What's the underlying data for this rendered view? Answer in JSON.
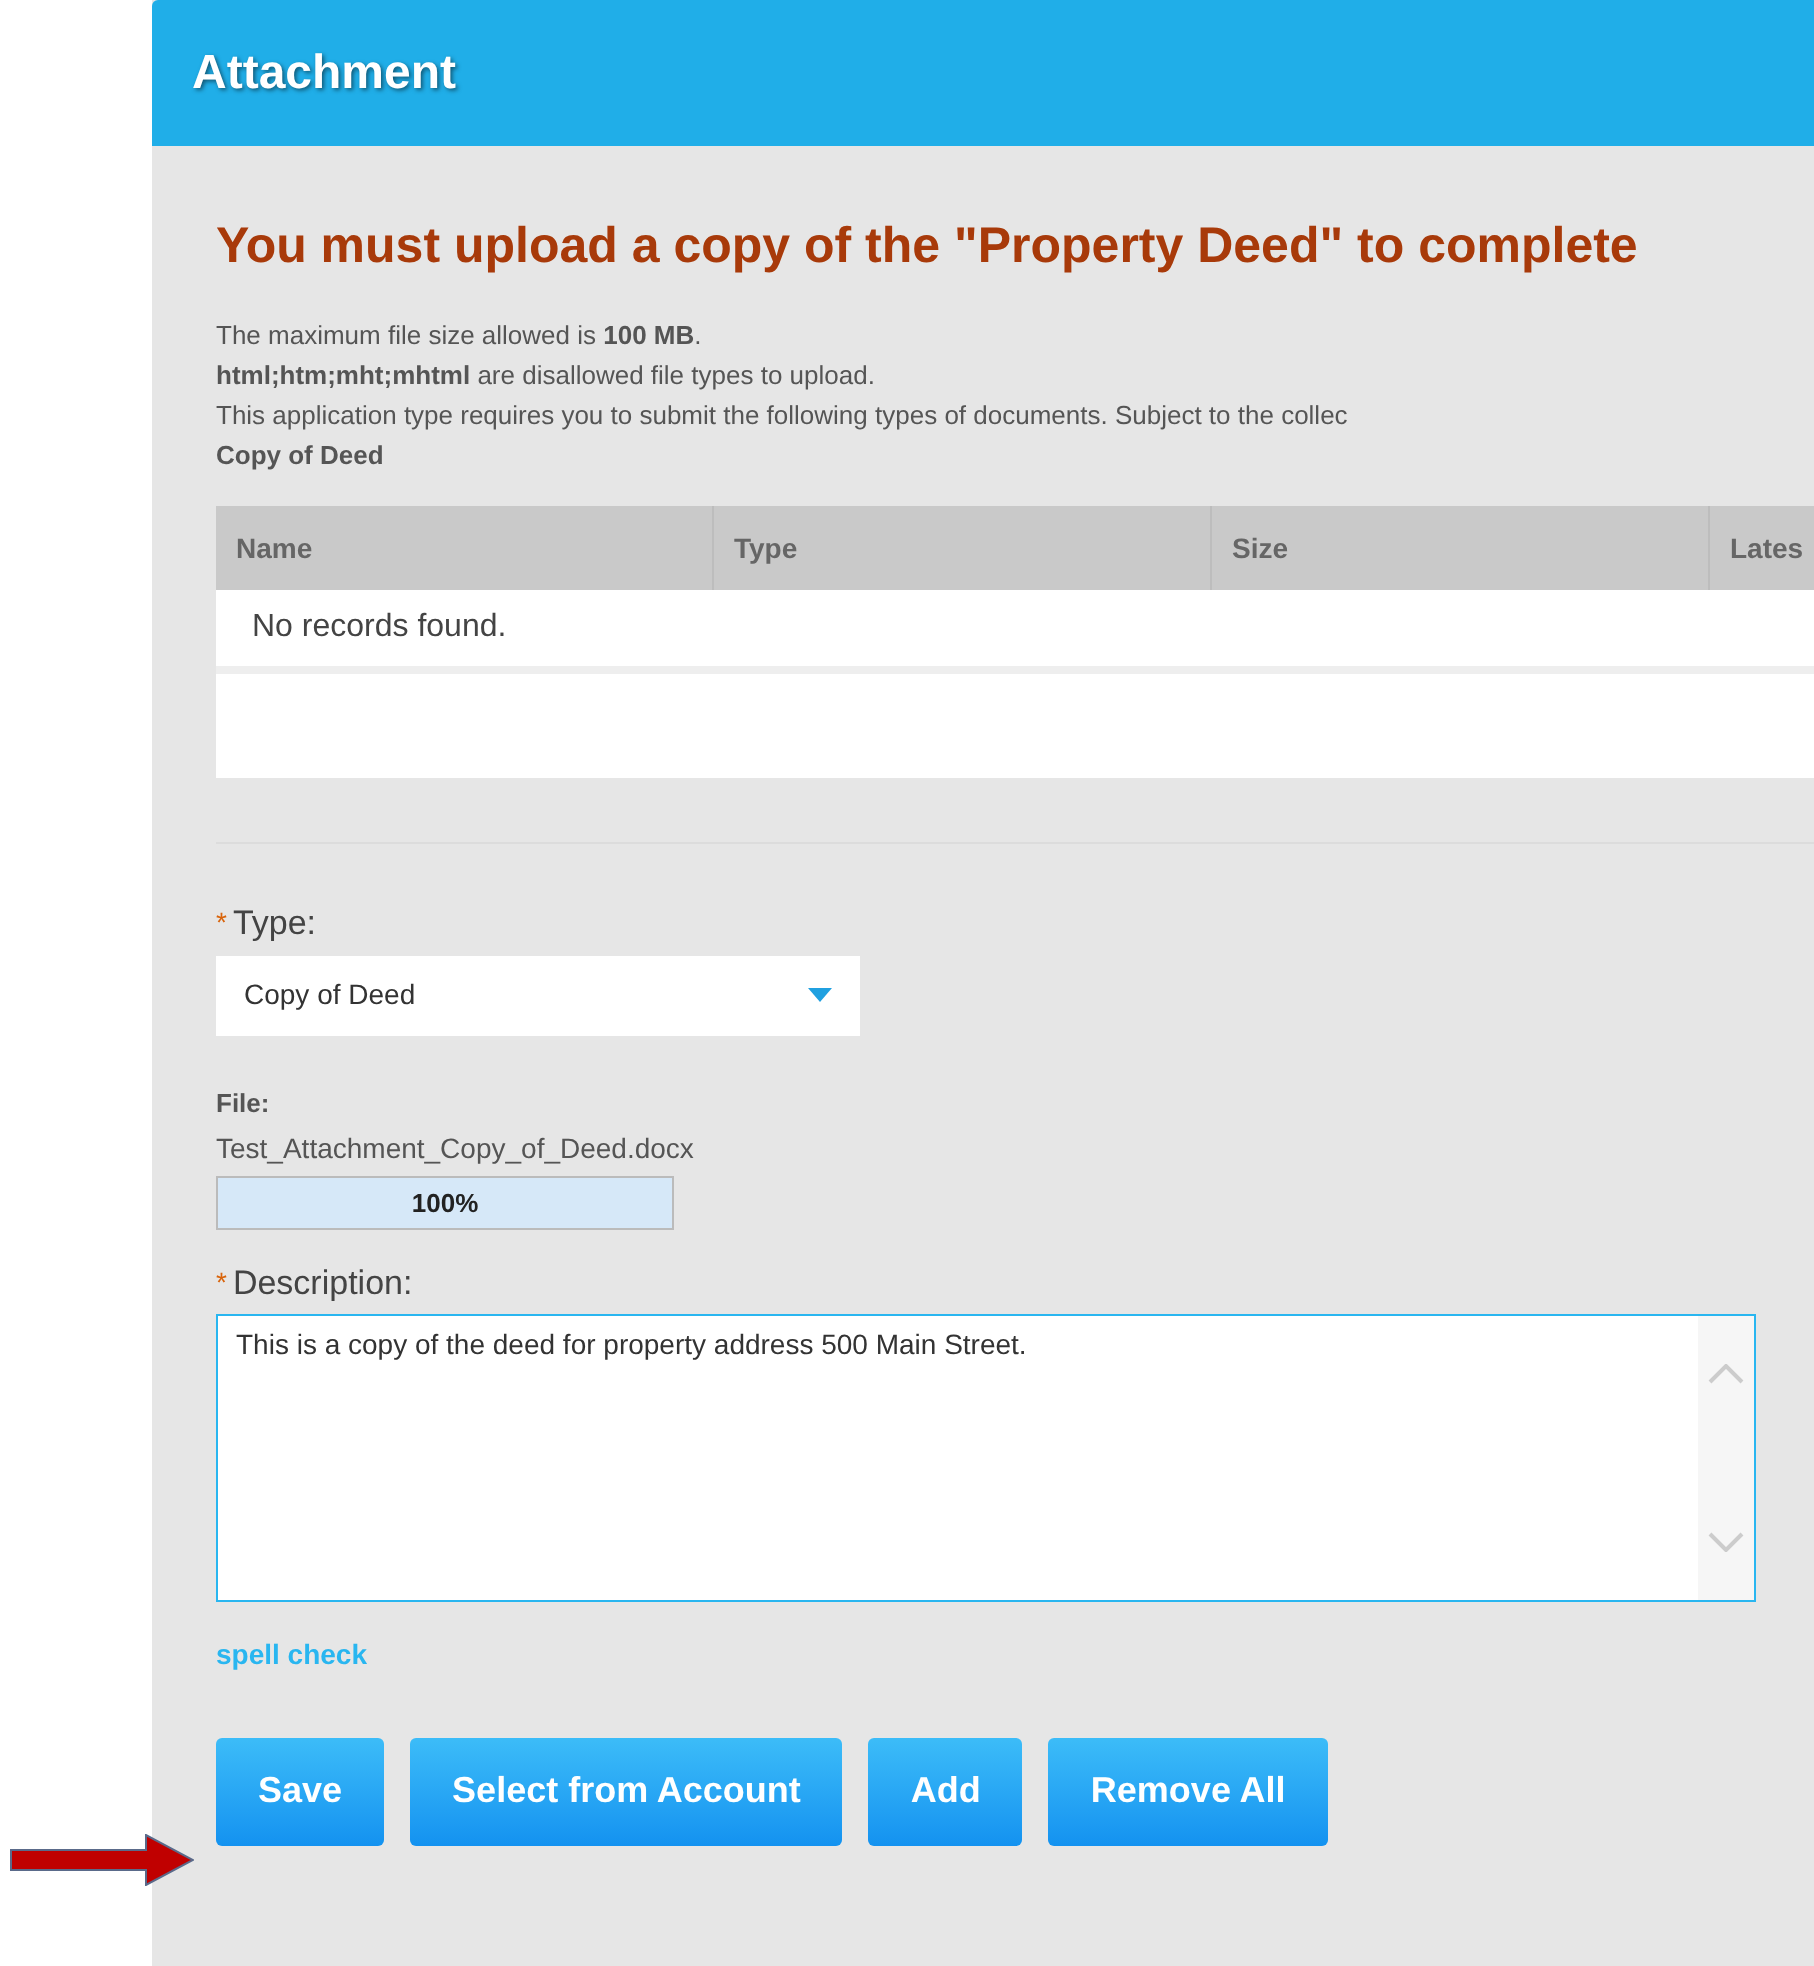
{
  "panel": {
    "title": "Attachment"
  },
  "notice": "You must upload a copy of the \"Property Deed\" to complete",
  "info_lines": [
    "The maximum file size allowed is **100 MB**.",
    "**html;htm;mht;mhtml** are disallowed file types to upload.",
    "This application type requires you to submit the following types of documents. Subject to the collec",
    "**Copy of Deed**"
  ],
  "table": {
    "columns": [
      "Name",
      "Type",
      "Size",
      "Lates"
    ],
    "empty_message": "No records found."
  },
  "type_field": {
    "label": "Type:",
    "required": true,
    "required_mark": "*",
    "value": "Copy of Deed"
  },
  "file": {
    "label": "File:",
    "name": "Test_Attachment_Copy_of_Deed.docx",
    "level": 1,
    "reading": "100%"
  },
  "description_field": {
    "label": "Description:",
    "required": true,
    "required_mark": "*",
    "value": "This is a copy of the deed for property address 500 Main Street."
  },
  "spell_check": "spell check",
  "buttons": [
    "Save",
    "Select from Account",
    "Add",
    "Remove All"
  ]
}
